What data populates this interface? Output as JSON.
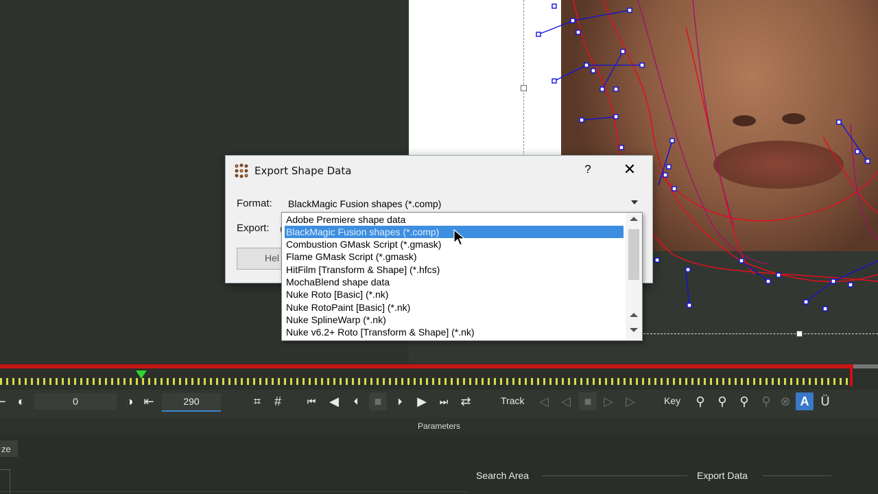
{
  "dialog": {
    "title": "Export Shape Data",
    "help_glyph": "?",
    "close_glyph": "✕",
    "format_label": "Format:",
    "format_value": "BlackMagic Fusion shapes (*.comp)",
    "export_label": "Export:",
    "help_button": "Hel"
  },
  "dropdown": {
    "selected_index": 1,
    "options": [
      "Adobe Premiere shape data",
      "BlackMagic Fusion shapes (*.comp)",
      "Combustion GMask Script (*.gmask)",
      "Flame GMask Script (*.gmask)",
      "HitFilm [Transform & Shape] (*.hfcs)",
      "MochaBlend shape data",
      "Nuke Roto [Basic] (*.nk)",
      "Nuke RotoPaint [Basic] (*.nk)",
      "Nuke SplineWarp (*.nk)",
      "Nuke v6.2+ Roto [Transform & Shape] (*.nk)"
    ]
  },
  "transport": {
    "in_frame": "0",
    "out_frame": "290",
    "track_label": "Track",
    "key_label": "Key"
  },
  "parameters": {
    "header": "Parameters",
    "tab_fragment": "ze",
    "search_area": "Search Area",
    "export_data": "Export Data"
  },
  "colors": {
    "accent_selection": "#3d8ee0",
    "timeline_red": "#c81414",
    "playhead_green": "#2fd42f",
    "spline_blue": "#1010e0",
    "spline_red": "#e01020"
  }
}
